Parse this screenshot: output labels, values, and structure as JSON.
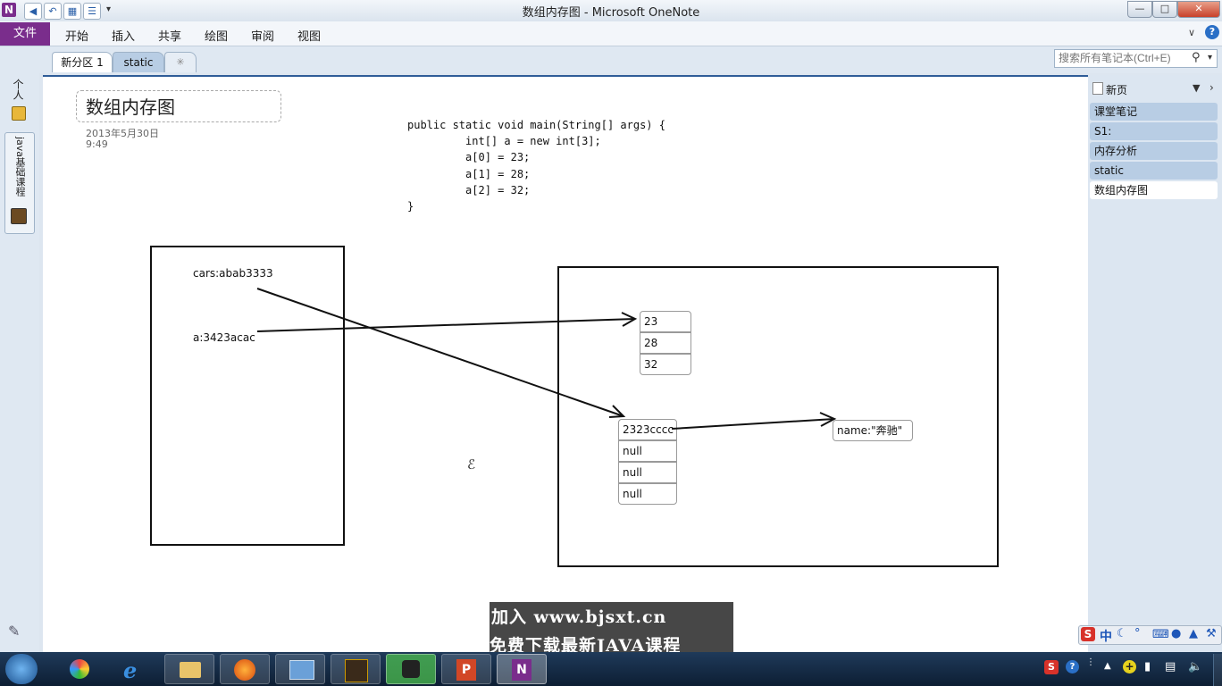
{
  "window": {
    "title": "数组内存图 - Microsoft OneNote",
    "app_icon": "N",
    "colors": {
      "accent": "#7a2d8c",
      "tab_active": "#2f5d98"
    }
  },
  "menu": {
    "file": "文件",
    "items": [
      "开始",
      "插入",
      "共享",
      "绘图",
      "审阅",
      "视图"
    ]
  },
  "sections": {
    "tabs": [
      "新分区 1",
      "static"
    ],
    "add_icon": "new-section-icon"
  },
  "search": {
    "placeholder": "搜索所有笔记本(Ctrl+E)"
  },
  "leftnav": {
    "notebook_personal": "个人",
    "notebook_java": "java基础课程"
  },
  "pagelist": {
    "new_page": "新页",
    "items": [
      "课堂笔记",
      "S1:",
      "内存分析",
      "static",
      "数组内存图"
    ]
  },
  "note": {
    "title": "数组内存图",
    "date": "2013年5月30日",
    "time": "9:49",
    "code": [
      "public static void main(String[] args) {",
      "         int[] a = new int[3];",
      "         a[0] = 23;",
      "         a[1] = 28;",
      "         a[2] = 32;",
      "}"
    ],
    "stack_labels": [
      "cars:abab3333",
      "a:3423acac"
    ],
    "int_array": [
      "23",
      "28",
      "32"
    ],
    "obj_array": [
      "2323cccc",
      "null",
      "null",
      "null"
    ],
    "object_label": "name:\"奔驰\""
  },
  "watermark": {
    "line1": "加入 www.bjsxt.cn",
    "line2": "免费下载最新JAVA课程"
  },
  "ime": {
    "label": "中"
  }
}
